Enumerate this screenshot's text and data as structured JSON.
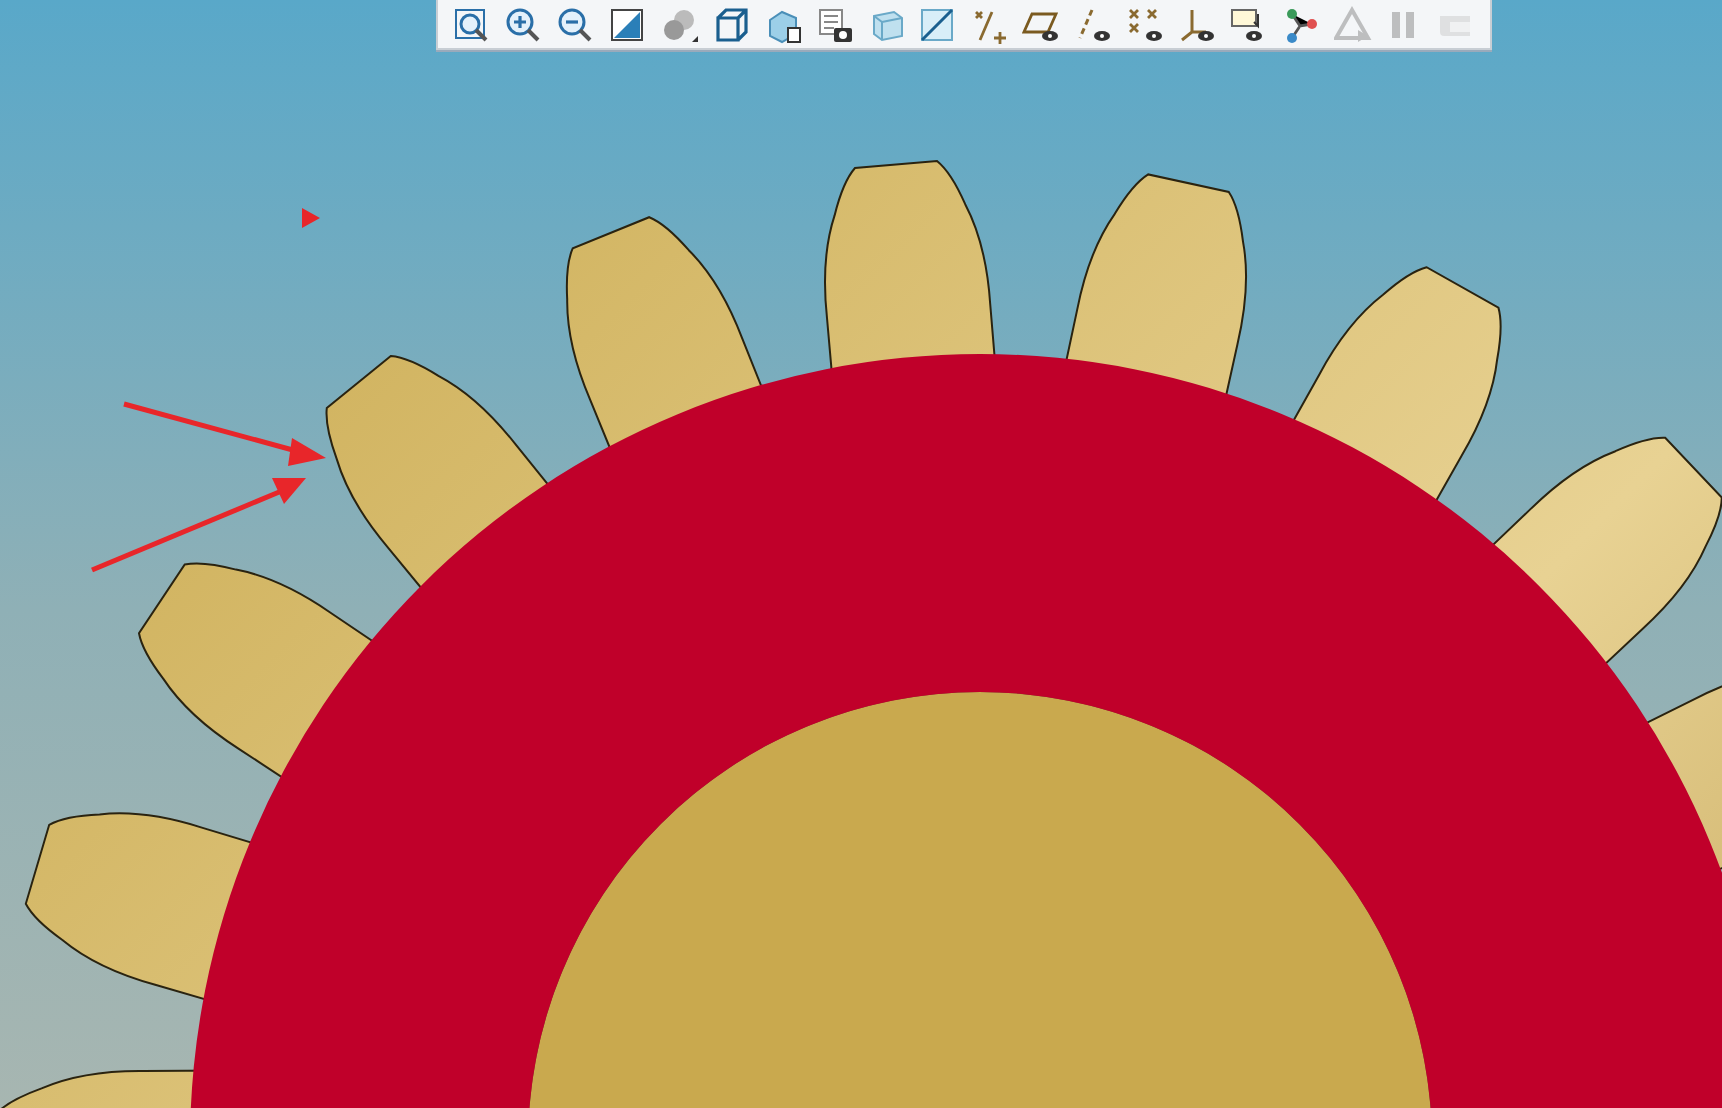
{
  "toolbar": {
    "buttons": [
      {
        "kind": "refit",
        "disabled": false
      },
      {
        "kind": "zoomin",
        "disabled": false
      },
      {
        "kind": "zoomout",
        "disabled": false
      },
      {
        "kind": "repaint",
        "disabled": false
      },
      {
        "kind": "appearance",
        "disabled": false
      },
      {
        "kind": "display",
        "disabled": false
      },
      {
        "kind": "views",
        "disabled": false
      },
      {
        "kind": "snapshot",
        "disabled": false
      },
      {
        "kind": "perspective",
        "disabled": false
      },
      {
        "kind": "section",
        "disabled": false
      },
      {
        "kind": "datums",
        "disabled": false
      },
      {
        "kind": "planes",
        "disabled": false
      },
      {
        "kind": "axes",
        "disabled": false
      },
      {
        "kind": "points",
        "disabled": false
      },
      {
        "kind": "csys",
        "disabled": false
      },
      {
        "kind": "annotations",
        "disabled": false
      },
      {
        "kind": "network",
        "disabled": false
      },
      {
        "kind": "spin",
        "disabled": true
      },
      {
        "kind": "pause",
        "disabled": true
      },
      {
        "kind": "flatten",
        "disabled": true
      }
    ]
  }
}
